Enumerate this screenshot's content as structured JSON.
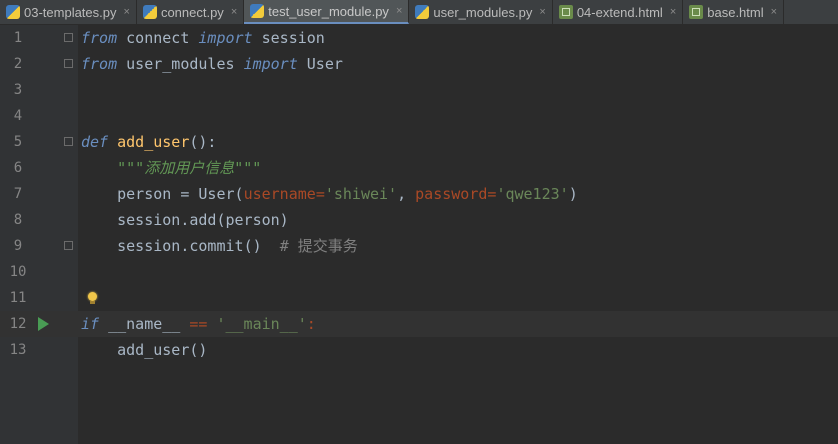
{
  "tabs": [
    {
      "label": "03-templates.py",
      "icon": "python-file-icon",
      "active": false
    },
    {
      "label": "connect.py",
      "icon": "python-file-icon",
      "active": false
    },
    {
      "label": "test_user_module.py",
      "icon": "python-file-icon",
      "active": true
    },
    {
      "label": "user_modules.py",
      "icon": "python-file-icon",
      "active": false
    },
    {
      "label": "04-extend.html",
      "icon": "html-file-icon",
      "active": false
    },
    {
      "label": "base.html",
      "icon": "html-file-icon",
      "active": false
    }
  ],
  "close_glyph": "×",
  "lines": [
    {
      "num": "1"
    },
    {
      "num": "2"
    },
    {
      "num": "3"
    },
    {
      "num": "4"
    },
    {
      "num": "5"
    },
    {
      "num": "6"
    },
    {
      "num": "7"
    },
    {
      "num": "8"
    },
    {
      "num": "9"
    },
    {
      "num": "10"
    },
    {
      "num": "11"
    },
    {
      "num": "12"
    },
    {
      "num": "13"
    }
  ],
  "code": {
    "l1": {
      "kw1": "from",
      "mod": " connect ",
      "kw2": "import",
      "name": " session"
    },
    "l2": {
      "kw1": "from",
      "mod": " user_modules ",
      "kw2": "import",
      "name": " User"
    },
    "l5": {
      "kw": "def",
      "sp": " ",
      "fn": "add_user",
      "rest": "():"
    },
    "l6": {
      "doc": "    \"\"\"添加用户信息\"\"\""
    },
    "l7": {
      "a": "    person = ",
      "cls": "User",
      "p1": "(",
      "k1": "username",
      "eq1": "=",
      "s1": "'shiwei'",
      "c": ", ",
      "k2": "password",
      "eq2": "=",
      "s2": "'qwe123'",
      "p2": ")"
    },
    "l8": {
      "a": "    session.",
      "m": "add",
      "b": "(person)"
    },
    "l9": {
      "a": "    session.",
      "m": "commit",
      "b": "()  ",
      "cmt": "# 提交事务"
    },
    "l12": {
      "kw": "if",
      "a": " __name__ ",
      "op": "==",
      "sp": " ",
      "s": "'__main__'",
      "colon": ":"
    },
    "l13": {
      "a": "    add_user()"
    }
  },
  "colors": {
    "keyword": "#cc7832",
    "keyword_import": "#6a8ebf",
    "string": "#6a8759",
    "comment": "#808080",
    "function": "#ffc66d",
    "parameter": "#aa4926",
    "text": "#a9b7c6",
    "background": "#2b2b2b"
  },
  "current_line": "12"
}
